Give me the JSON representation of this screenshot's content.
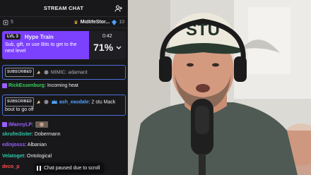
{
  "chat": {
    "title": "STREAM CHAT",
    "leaderboard": {
      "rank_count": "5",
      "name": "MidlifeStor...",
      "count": "10"
    },
    "hype_train": {
      "level": "LVL 3",
      "title": "Hype Train",
      "description": "Sub, gift, or use Bits to get to the next level",
      "time": "0:42",
      "percent": "71%"
    },
    "messages": [
      {
        "badge": "SUBSCRIBED",
        "user": "MIMIC",
        "text": ": adamant"
      },
      {
        "user": "RickEssenburg",
        "text": ": Incoming heat"
      },
      {
        "badge": "SUBSCRIBED",
        "user": "ash_easdale",
        "text": ": 2 stu Mack bout to go off"
      },
      {
        "user": "iMannyLP",
        "text": ":"
      },
      {
        "user": "skrufm3ister",
        "text": ": Dobermann"
      },
      {
        "user": "edinjosss",
        "text": ": Albanian"
      },
      {
        "user": "Velatoget",
        "text": ": Ontological"
      },
      {
        "user": "deco_p"
      }
    ],
    "paused_text": "Chat paused due to scroll"
  },
  "video": {
    "cap_text": "STU"
  },
  "colors": {
    "hype_purple": "#7c40ff",
    "sub_border": "#4b6ed6",
    "chat_bg": "#18181b"
  }
}
